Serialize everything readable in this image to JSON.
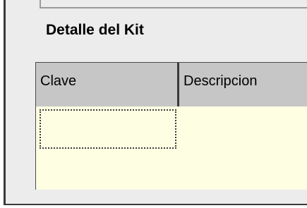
{
  "section": {
    "title": "Detalle del Kit"
  },
  "grid": {
    "columns": [
      "Clave",
      "Descripcion"
    ],
    "rows": [
      [
        "",
        ""
      ]
    ],
    "colors": {
      "background": "#fefee3",
      "header": "#c6c6c6"
    }
  }
}
